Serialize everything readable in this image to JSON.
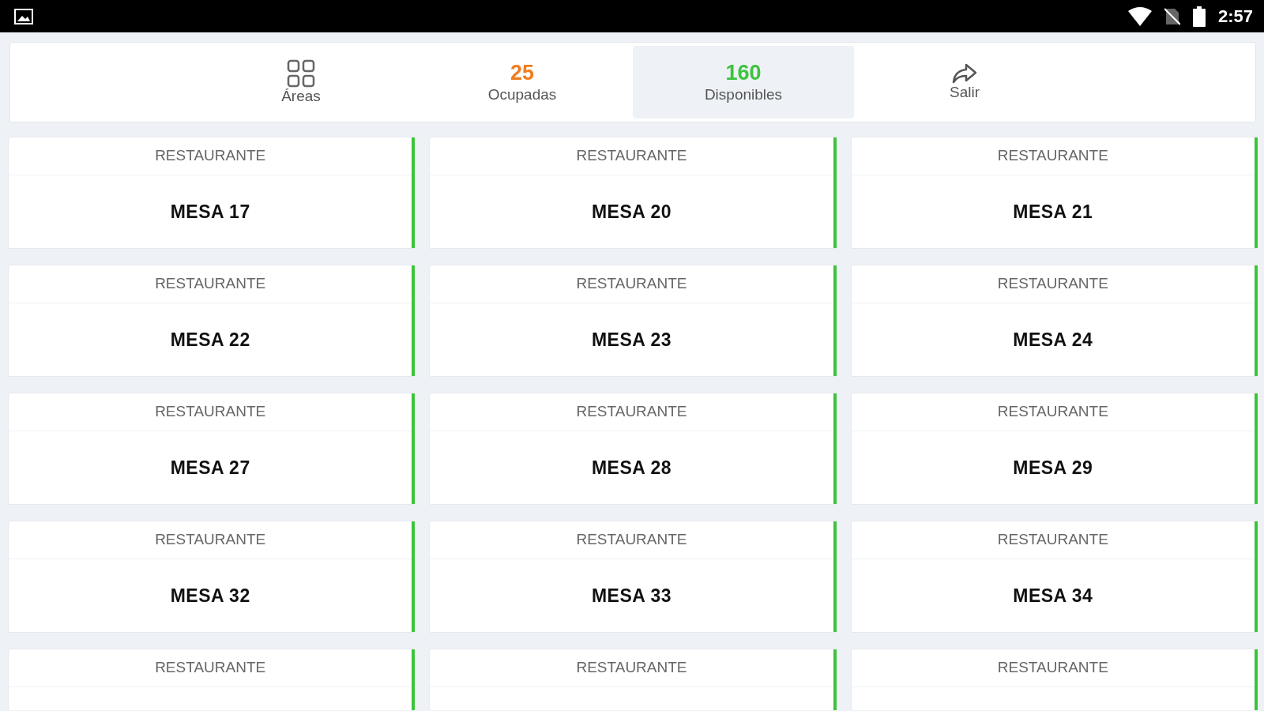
{
  "status_bar": {
    "time": "2:57"
  },
  "tabs": [
    {
      "kind": "grid",
      "label": "Áreas",
      "selected": false
    },
    {
      "kind": "count",
      "count": "25",
      "label": "Ocupadas",
      "color": "#f07c1e",
      "selected": false
    },
    {
      "kind": "count",
      "count": "160",
      "label": "Disponibles",
      "color": "#3cc43c",
      "selected": true
    },
    {
      "kind": "arrow",
      "label": "Salir",
      "selected": false
    }
  ],
  "tables": [
    {
      "area": "RESTAURANTE",
      "name": "MESA 17",
      "color": "#3cc43c"
    },
    {
      "area": "RESTAURANTE",
      "name": "MESA 20",
      "color": "#3cc43c"
    },
    {
      "area": "RESTAURANTE",
      "name": "MESA 21",
      "color": "#3cc43c"
    },
    {
      "area": "RESTAURANTE",
      "name": "MESA 22",
      "color": "#3cc43c"
    },
    {
      "area": "RESTAURANTE",
      "name": "MESA 23",
      "color": "#3cc43c"
    },
    {
      "area": "RESTAURANTE",
      "name": "MESA 24",
      "color": "#3cc43c"
    },
    {
      "area": "RESTAURANTE",
      "name": "MESA 27",
      "color": "#3cc43c"
    },
    {
      "area": "RESTAURANTE",
      "name": "MESA 28",
      "color": "#3cc43c"
    },
    {
      "area": "RESTAURANTE",
      "name": "MESA 29",
      "color": "#3cc43c"
    },
    {
      "area": "RESTAURANTE",
      "name": "MESA 32",
      "color": "#3cc43c"
    },
    {
      "area": "RESTAURANTE",
      "name": "MESA 33",
      "color": "#3cc43c"
    },
    {
      "area": "RESTAURANTE",
      "name": "MESA 34",
      "color": "#3cc43c"
    },
    {
      "area": "RESTAURANTE",
      "color": "#3cc43c"
    },
    {
      "area": "RESTAURANTE",
      "color": "#3cc43c"
    },
    {
      "area": "RESTAURANTE",
      "color": "#3cc43c"
    }
  ]
}
